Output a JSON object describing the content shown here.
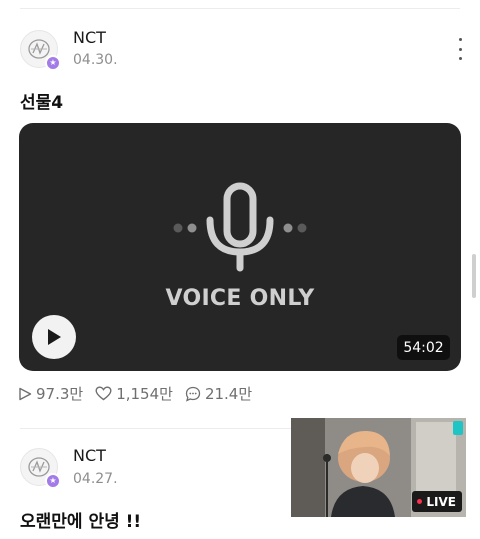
{
  "posts": [
    {
      "author": "NCT",
      "date": "04.30.",
      "title": "선물4",
      "media": {
        "type": "voice",
        "label": "VOICE ONLY",
        "duration": "54:02"
      },
      "stats": {
        "views": "97.3만",
        "likes": "1,154만",
        "comments": "21.4만"
      }
    },
    {
      "author": "NCT",
      "date": "04.27.",
      "title": "오랜만에 안녕 !!"
    }
  ],
  "live_preview": {
    "badge": "LIVE"
  },
  "colors": {
    "badge_purple": "#a37be8",
    "live_red": "#ff2e4e",
    "media_bg": "#262626"
  }
}
